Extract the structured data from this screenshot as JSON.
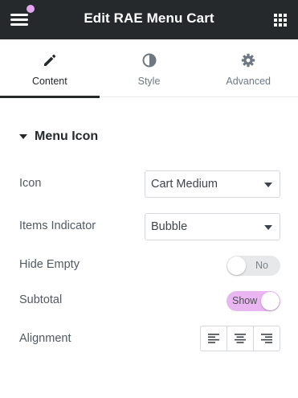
{
  "header": {
    "title": "Edit RAE Menu Cart",
    "menu_icon": "hamburger-menu-icon",
    "apps_icon": "grid-apps-icon",
    "notification_dot_color": "#e5a6f0"
  },
  "tabs": [
    {
      "label": "Content",
      "icon": "pencil-icon",
      "active": true
    },
    {
      "label": "Style",
      "icon": "half-circle-icon",
      "active": false
    },
    {
      "label": "Advanced",
      "icon": "gear-icon",
      "active": false
    }
  ],
  "section": {
    "title": "Menu Icon",
    "icon": "caret-down-icon"
  },
  "controls": {
    "icon": {
      "label": "Icon",
      "value": "Cart Medium"
    },
    "items_indicator": {
      "label": "Items Indicator",
      "value": "Bubble"
    },
    "hide_empty": {
      "label": "Hide Empty",
      "state": "No"
    },
    "subtotal": {
      "label": "Subtotal",
      "state": "Show"
    },
    "alignment": {
      "label": "Alignment",
      "options": [
        "align-left-icon",
        "align-center-icon",
        "align-right-icon"
      ]
    }
  },
  "colors": {
    "header_bg": "#26292c",
    "toggle_on": "#e9b6f2",
    "toggle_off": "#e6e8ea"
  }
}
